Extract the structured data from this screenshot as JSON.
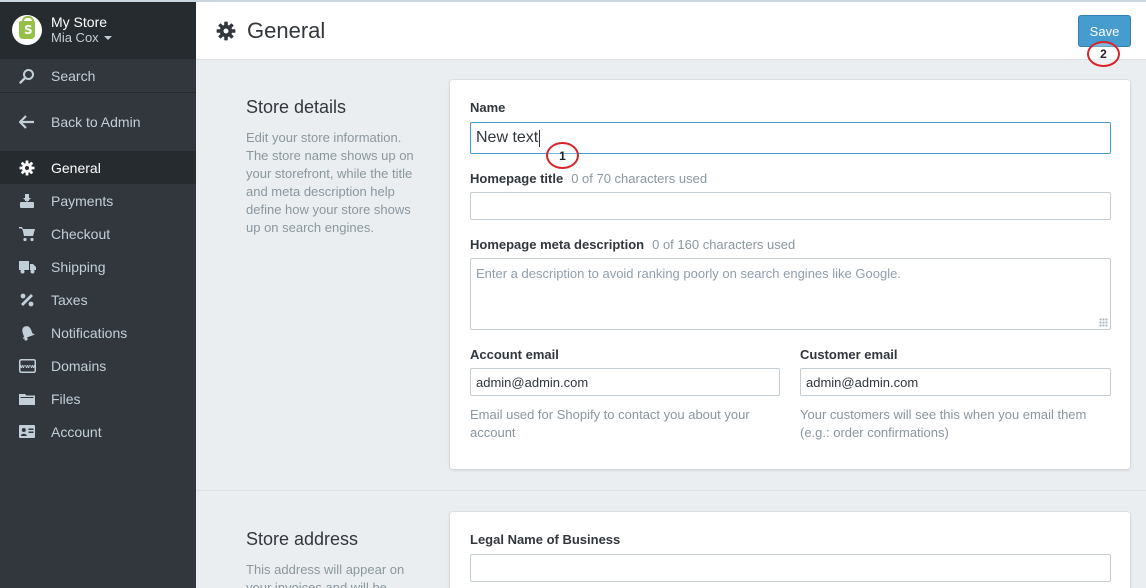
{
  "sidebar": {
    "store_name": "My Store",
    "user_name": "Mia Cox",
    "search_label": "Search",
    "back_label": "Back to Admin",
    "items": [
      {
        "label": "General",
        "icon": "gear-icon",
        "active": true
      },
      {
        "label": "Payments",
        "icon": "payments-icon"
      },
      {
        "label": "Checkout",
        "icon": "cart-icon"
      },
      {
        "label": "Shipping",
        "icon": "truck-icon"
      },
      {
        "label": "Taxes",
        "icon": "percent-icon"
      },
      {
        "label": "Notifications",
        "icon": "bell-icon"
      },
      {
        "label": "Domains",
        "icon": "www-icon"
      },
      {
        "label": "Files",
        "icon": "folder-icon"
      },
      {
        "label": "Account",
        "icon": "id-card-icon"
      }
    ]
  },
  "header": {
    "title": "General",
    "save_label": "Save"
  },
  "store_details": {
    "title": "Store details",
    "description": "Edit your store information. The store name shows up on your storefront, while the title and meta description help define how your store shows up on search engines.",
    "name_label": "Name",
    "name_value": "New text",
    "homepage_title_label": "Homepage title",
    "homepage_title_hint": "0 of 70 characters used",
    "homepage_title_value": "",
    "meta_label": "Homepage meta description",
    "meta_hint": "0 of 160 characters used",
    "meta_placeholder": "Enter a description to avoid ranking poorly on search engines like Google.",
    "account_email_label": "Account email",
    "account_email_value": "admin@admin.com",
    "account_email_help": "Email used for Shopify to contact you about your account",
    "customer_email_label": "Customer email",
    "customer_email_value": "admin@admin.com",
    "customer_email_help": "Your customers will see this when you email them (e.g.: order confirmations)"
  },
  "store_address": {
    "title": "Store address",
    "description": "This address will appear on your invoices and will be",
    "legal_name_label": "Legal Name of Business",
    "legal_name_value": ""
  },
  "annotations": {
    "marker_1": "1",
    "marker_2": "2"
  },
  "colors": {
    "sidebar_bg": "#31373d",
    "accent": "#479ccf",
    "marker": "#d9232a",
    "shopify_green": "#95bf47"
  }
}
